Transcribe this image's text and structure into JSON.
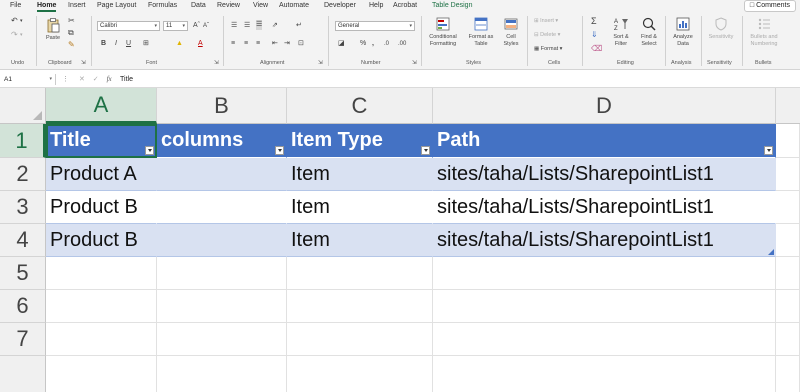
{
  "menu": {
    "tabs": [
      "File",
      "Home",
      "Insert",
      "Page Layout",
      "Formulas",
      "Data",
      "Review",
      "View",
      "Automate",
      "Developer",
      "Help",
      "Acrobat",
      "Table Design"
    ],
    "active_tab": "Home",
    "comments_label": "Comments"
  },
  "ribbon": {
    "groups": {
      "undo": "Undo",
      "clipboard": "Clipboard",
      "font": "Font",
      "alignment": "Alignment",
      "number": "Number",
      "styles": "Styles",
      "cells": "Cells",
      "editing": "Editing",
      "analysis": "Analysis",
      "sensitivity": "Sensitivity",
      "bullets": "Bullets"
    },
    "paste_label": "Paste",
    "font_name": "Calibri",
    "font_size": "11",
    "number_format": "General",
    "conditional_formatting": [
      "Conditional",
      "Formatting"
    ],
    "format_as_table": [
      "Format as",
      "Table"
    ],
    "cell_styles": [
      "Cell",
      "Styles"
    ],
    "insert_label": "Insert",
    "delete_label": "Delete",
    "format_label": "Format",
    "sort_filter": [
      "Sort &",
      "Filter"
    ],
    "find_select": [
      "Find &",
      "Select"
    ],
    "analyze_data": [
      "Analyze",
      "Data"
    ],
    "sensitivity_label": "Sensitivity",
    "bullets_numbering": [
      "Bullets and",
      "Numbering"
    ]
  },
  "formula_bar": {
    "name_box": "A1",
    "fx": "fx",
    "content": "Title"
  },
  "sheet": {
    "columns": [
      "A",
      "B",
      "C",
      "D"
    ],
    "rows": [
      "1",
      "2",
      "3",
      "4",
      "5",
      "6",
      "7"
    ],
    "active_cell": "A1",
    "table": {
      "headers": [
        "Title",
        "columns",
        "Item Type",
        "Path"
      ],
      "rows": [
        [
          "Product A",
          "",
          "Item",
          "sites/taha/Lists/SharepointList1"
        ],
        [
          "Product B",
          "",
          "Item",
          "sites/taha/Lists/SharepointList1"
        ],
        [
          "Product B",
          "",
          "Item",
          "sites/taha/Lists/SharepointList1"
        ]
      ]
    },
    "colors": {
      "table_header": "#4472c4",
      "band": "#d9e1f2",
      "selection": "#1e7145"
    }
  }
}
